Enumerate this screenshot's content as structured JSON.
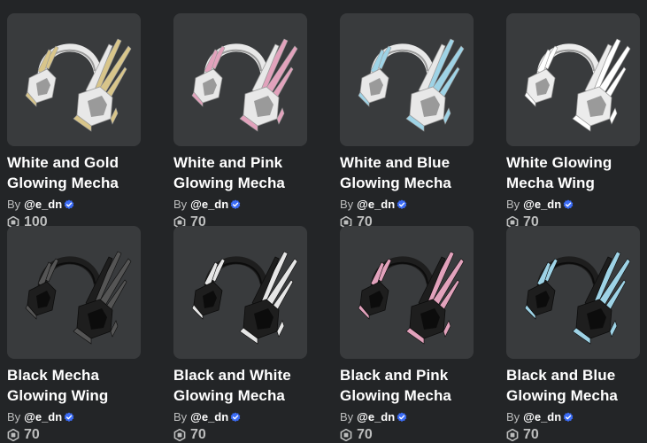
{
  "by_label": "By",
  "items": [
    {
      "name": "White and Gold Glowing Mecha",
      "creator": "@e_dn",
      "price": "100",
      "base": "#e8e8e8",
      "accent": "#d8c58a",
      "dark": "#9a9a9a"
    },
    {
      "name": "White and Pink Glowing Mecha",
      "creator": "@e_dn",
      "price": "70",
      "base": "#e8e8e8",
      "accent": "#e2a2bc",
      "dark": "#9a9a9a"
    },
    {
      "name": "White and Blue Glowing Mecha",
      "creator": "@e_dn",
      "price": "70",
      "base": "#e8e8e8",
      "accent": "#9ed3e6",
      "dark": "#9a9a9a"
    },
    {
      "name": "White Glowing Mecha Wing",
      "creator": "@e_dn",
      "price": "70",
      "base": "#ececec",
      "accent": "#ffffff",
      "dark": "#9a9a9a"
    },
    {
      "name": "Black Mecha Glowing Wing",
      "creator": "@e_dn",
      "price": "70",
      "base": "#1e1e1e",
      "accent": "#555555",
      "dark": "#0c0c0c"
    },
    {
      "name": "Black and White Glowing Mecha",
      "creator": "@e_dn",
      "price": "70",
      "base": "#1e1e1e",
      "accent": "#e6e6e6",
      "dark": "#0c0c0c"
    },
    {
      "name": "Black and Pink Glowing Mecha",
      "creator": "@e_dn",
      "price": "70",
      "base": "#1e1e1e",
      "accent": "#e2a2bc",
      "dark": "#0c0c0c"
    },
    {
      "name": "Black and Blue Glowing Mecha",
      "creator": "@e_dn",
      "price": "70",
      "base": "#1e1e1e",
      "accent": "#9ed3e6",
      "dark": "#0c0c0c"
    }
  ]
}
